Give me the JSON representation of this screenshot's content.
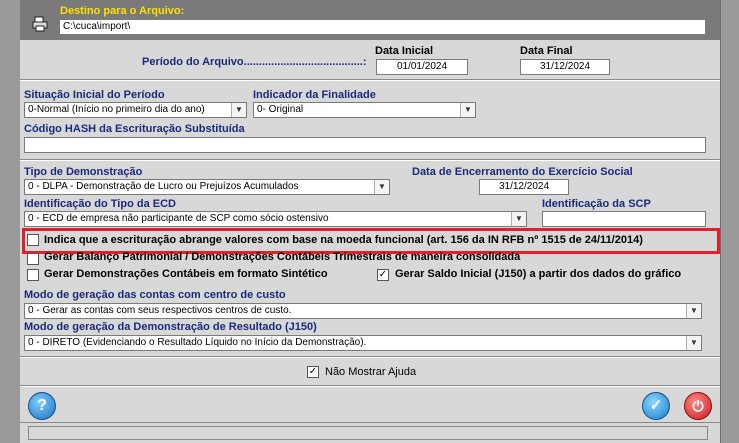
{
  "destino": {
    "label": "Destino para o Arquivo:",
    "value": "C:\\cuca\\import\\"
  },
  "periodo": {
    "label": "Período do Arquivo.......................................:",
    "data_inicial_label": "Data Inicial",
    "data_inicial": "01/01/2024",
    "data_final_label": "Data Final",
    "data_final": "31/12/2024"
  },
  "situacao": {
    "label": "Situação Inicial do Período",
    "value": "0-Normal (Início no primeiro dia do ano)"
  },
  "finalidade": {
    "label": "Indicador da Finalidade",
    "value": "0- Original"
  },
  "hash": {
    "label": "Código HASH da Escrituração Substituída",
    "value": ""
  },
  "tipo_demo": {
    "label": "Tipo de Demonstração",
    "value": "0 - DLPA - Demonstração de Lucro ou Prejuízos Acumulados"
  },
  "encerramento": {
    "label": "Data de Encerramento do Exercício Social",
    "value": "31/12/2024"
  },
  "ident_ecd": {
    "label": "Identificação do Tipo da ECD",
    "value": "0 - ECD de empresa não participante de SCP como sócio ostensivo"
  },
  "ident_scp": {
    "label": "Identificação da SCP",
    "value": ""
  },
  "checks": {
    "moeda_funcional": {
      "label": "Indica que a escrituração abrange valores com base na moeda funcional (art. 156 da IN RFB nº 1515 de 24/11/2014)",
      "checked": false
    },
    "balanco_trimestral": {
      "label": "Gerar Balanço Patrimonial / Demonstrações Contábeis Trimestrais de maneira consolidada",
      "checked": false
    },
    "formato_sintetico": {
      "label": "Gerar Demonstrações Contábeis em formato Sintético",
      "checked": false
    },
    "saldo_inicial": {
      "label": "Gerar Saldo Inicial (J150) a partir dos dados do gráfico",
      "checked": true
    },
    "nao_mostrar_ajuda": {
      "label": "Não Mostrar Ajuda",
      "checked": true
    }
  },
  "modo_contas": {
    "label": "Modo de geração das contas com centro de custo",
    "value": "0 - Gerar as contas com seus respectivos centros de custo."
  },
  "modo_dre": {
    "label": "Modo de geração da Demonstração de Resultado (J150)",
    "value": "0 - DIRETO (Evidenciando o Resultado Líquido no Início da Demonstração)."
  },
  "colors": {
    "highlight": "#e0202a",
    "label_blue": "#1a2a7a",
    "destino_yellow": "#ffe000"
  }
}
